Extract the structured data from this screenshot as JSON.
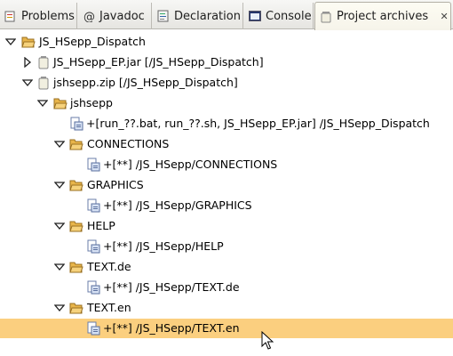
{
  "tabs": [
    {
      "label": "Problems",
      "icon": "problems-icon",
      "active": false
    },
    {
      "label": "Javadoc",
      "icon": "at-sign-icon",
      "active": false
    },
    {
      "label": "Declaration",
      "icon": "declaration-icon",
      "active": false
    },
    {
      "label": "Console",
      "icon": "console-icon",
      "active": false
    },
    {
      "label": "Project archives",
      "icon": "archive-jar-icon",
      "active": true,
      "close": "✕"
    }
  ],
  "tree": {
    "root": "JS_HSepp_Dispatch",
    "jar": "JS_HSepp_EP.jar [/JS_HSepp_Dispatch]",
    "zip": "jshsepp.zip [/JS_HSepp_Dispatch]",
    "folder_jshsepp": "jshsepp",
    "fileset_root": "+[run_??.bat, run_??.sh, JS_HSepp_EP.jar] /JS_HSepp_Dispatch",
    "connections": "CONNECTIONS",
    "connections_fs": "+[**] /JS_HSepp/CONNECTIONS",
    "graphics": "GRAPHICS",
    "graphics_fs": "+[**] /JS_HSepp/GRAPHICS",
    "help": "HELP",
    "help_fs": "+[**] /JS_HSepp/HELP",
    "text_de": "TEXT.de",
    "text_de_fs": "+[**] /JS_HSepp/TEXT.de",
    "text_en": "TEXT.en",
    "text_en_fs": "+[**] /JS_HSepp/TEXT.en"
  },
  "colors": {
    "selection": "#fbcf7f",
    "folder": "#e8b54a",
    "tab_bar": "#e6e5e1"
  }
}
